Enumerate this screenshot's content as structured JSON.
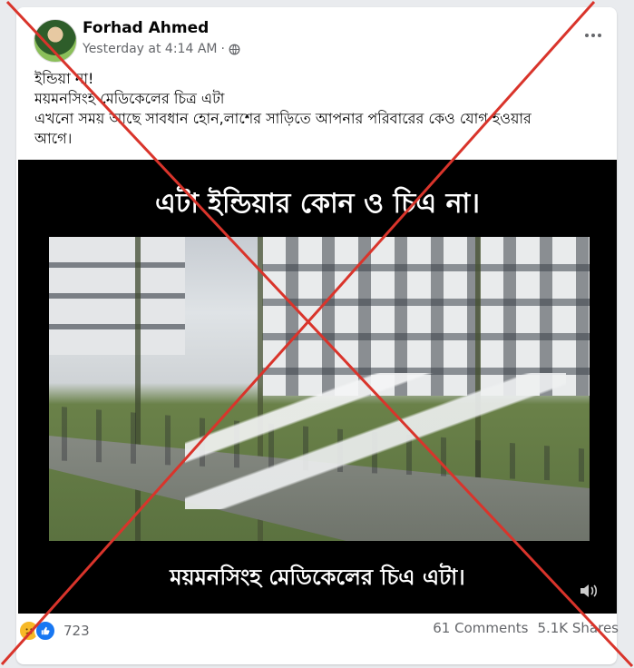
{
  "post": {
    "author": "Forhad Ahmed",
    "timestamp": "Yesterday at 4:14 AM",
    "separator": "·",
    "privacy_icon": "globe-icon",
    "more_icon": "more-horizontal-icon",
    "text_lines": [
      "ইন্ডিয়া না!",
      "ময়মনসিংহ মেডিকেলের চিত্র এটা",
      "এখনো সময় আছে সাবধান হোন,লাশের সাড়িতে আপনার পরিবারের কেও যোগ হওয়ার",
      "আগে।"
    ]
  },
  "video": {
    "caption_top": "এটা ইন্ডিয়ার কোন ও চিএ না।",
    "caption_bottom": "ময়মনসিংহ মেডিকেলের চিএ এটা।",
    "volume_icon": "volume-icon"
  },
  "engagement": {
    "reaction_icons": [
      "sad-reaction-icon",
      "like-reaction-icon"
    ],
    "reaction_count": "723",
    "comments": "61 Comments",
    "shares": "5.1K Shares"
  },
  "overlay": {
    "mark": "red-x-icon",
    "color": "#d9342b"
  },
  "colors": {
    "background": "#e9ebee",
    "card": "#ffffff",
    "secondary_text": "#65676b",
    "like_blue": "#1877f2"
  }
}
